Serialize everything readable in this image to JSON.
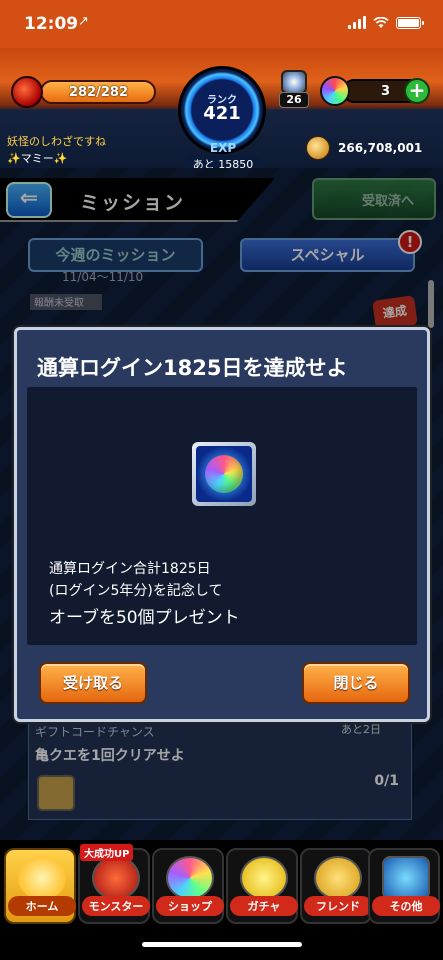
{
  "status_bar": {
    "time": "12:09",
    "location_arrow": "↗"
  },
  "header": {
    "stamina": "282/282",
    "rank_label": "ランク",
    "rank": "421",
    "exp_label": "EXP",
    "exp_remaining": "あと 15850",
    "luck_count": "26",
    "orbs": "3",
    "orb_add": "+",
    "player_title": "妖怪のしわざですね",
    "player_name": "✨マミー✨",
    "coins": "266,708,001"
  },
  "page": {
    "back": "⇐",
    "title": "ミッション",
    "received_button": "受取済へ",
    "tab_weekly": "今週のミッション",
    "tab_special": "スペシャル",
    "alert": "!",
    "week_range": "11/04〜11/10",
    "uncollected_tag": "報酬未受取",
    "achieved_tag": "達成"
  },
  "background_mission": {
    "gift_label": "ギフトコードチャンス",
    "time_left": "あと2日",
    "name": "亀クエを1回クリアせよ",
    "progress": "0/1"
  },
  "modal": {
    "title": "通算ログイン1825日を達成せよ",
    "reward_icon": "orb-icon",
    "description_line1": "通算ログイン合計1825日",
    "description_line2": "(ログイン5年分)を記念して",
    "description_line3": "オーブを50個プレゼント",
    "receive_button": "受け取る",
    "close_button": "閉じる"
  },
  "nav": {
    "promo": "大成功UP",
    "items": [
      {
        "label": "ホーム",
        "icon": "home-icon"
      },
      {
        "label": "モンスター",
        "icon": "monster-icon"
      },
      {
        "label": "ショップ",
        "icon": "shop-orb-icon"
      },
      {
        "label": "ガチャ",
        "icon": "gacha-icon"
      },
      {
        "label": "フレンド",
        "icon": "friend-icon"
      },
      {
        "label": "その他",
        "icon": "other-icon"
      }
    ]
  },
  "colors": {
    "header_orange": "#e0611a",
    "button_orange": "#e5670f",
    "modal_border": "#c8d2e6",
    "modal_bg": "#2a3a5e",
    "tab_special_blue": "#3a6ed8",
    "alert_red": "#d31818"
  }
}
